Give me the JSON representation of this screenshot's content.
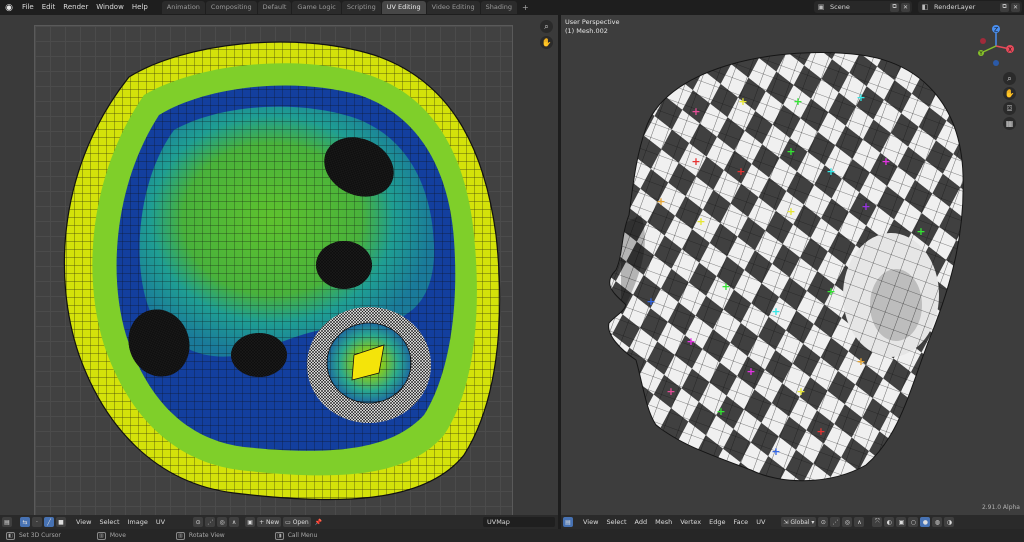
{
  "topbar": {
    "menus": [
      "File",
      "Edit",
      "Render",
      "Window",
      "Help"
    ],
    "workspace_tabs": [
      "Animation",
      "Compositing",
      "Default",
      "Game Logic",
      "Scripting",
      "UV Editing",
      "Video Editing",
      "Shading"
    ],
    "active_tab": "UV Editing",
    "add_tab": "+",
    "scene": "Scene",
    "render_layer": "RenderLayer"
  },
  "uv_editor": {
    "header_menus": [
      "View",
      "Select",
      "Image",
      "UV"
    ],
    "new_label": "New",
    "open_label": "Open",
    "uvmap_value": "UVMap"
  },
  "viewport": {
    "title": "User Perspective",
    "subtitle": "(1) Mesh.002",
    "header_menus": [
      "View",
      "Select",
      "Add",
      "Mesh",
      "Vertex",
      "Edge",
      "Face",
      "UV"
    ],
    "orientation": "Global",
    "version": "2.91.0 Alpha",
    "gizmo_axes": [
      "X",
      "Y",
      "Z"
    ]
  },
  "statusbar": {
    "items": [
      "Set 3D Cursor",
      "Move",
      "Rotate View",
      "Call Menu"
    ]
  },
  "colors": {
    "uv_yellow": "#d4e20a",
    "uv_green": "#5ec22e",
    "uv_teal": "#1f9e93",
    "uv_blue": "#133f9e",
    "active_tab": "#474747",
    "accent_blue": "#4772b3"
  }
}
